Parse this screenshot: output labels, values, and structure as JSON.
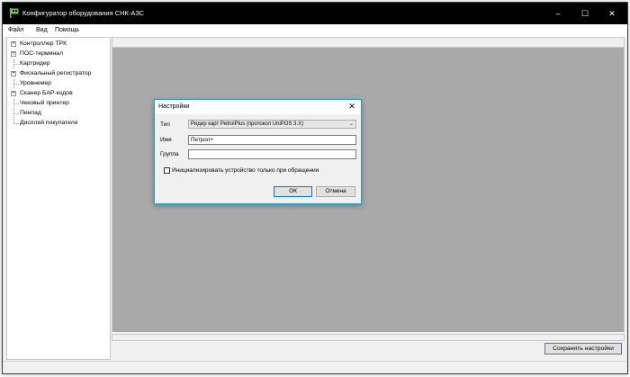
{
  "window": {
    "title": "Конфигуратор оборудования СНК-АЗС",
    "icon": "app-flag-icon",
    "controls": {
      "minimize": "–",
      "maximize": "☐",
      "close": "✕"
    }
  },
  "menu": {
    "items": [
      {
        "label": "Файл"
      },
      {
        "label": "Вид"
      },
      {
        "label": "Помощь"
      }
    ]
  },
  "tree": {
    "items": [
      {
        "label": "Контроллер ТРК",
        "expandable": true
      },
      {
        "label": "ПОС-терминал",
        "expandable": true
      },
      {
        "label": "Картридер",
        "expandable": false
      },
      {
        "label": "Фискальный регистратор",
        "expandable": true
      },
      {
        "label": "Уровнемер",
        "expandable": false
      },
      {
        "label": "Сканер БАР-кодов",
        "expandable": true
      },
      {
        "label": "Чековый принтер",
        "expandable": false
      },
      {
        "label": "Пинпад",
        "expandable": false
      },
      {
        "label": "Дисплей покупателя",
        "expandable": false
      }
    ]
  },
  "dialog": {
    "title": "Настройки",
    "close_glyph": "✕",
    "type_label": "Тип",
    "type_value": "Ридер карт PetrolPlus (протокол UniPOS 3.X)",
    "name_label": "Имя",
    "name_value": "Петрол+",
    "group_label": "Группа",
    "group_value": "",
    "checkbox_label": "Инициализировать устройство только при обращении",
    "checkbox_checked": false,
    "ok_label": "ОК",
    "cancel_label": "Отмена"
  },
  "footer": {
    "save_label": "Сохранить настройки"
  },
  "colors": {
    "titlebar": "#000000",
    "canvas": "#a9a9a9",
    "dialog_border": "#1aa5c4",
    "accent": "#0078d7"
  }
}
